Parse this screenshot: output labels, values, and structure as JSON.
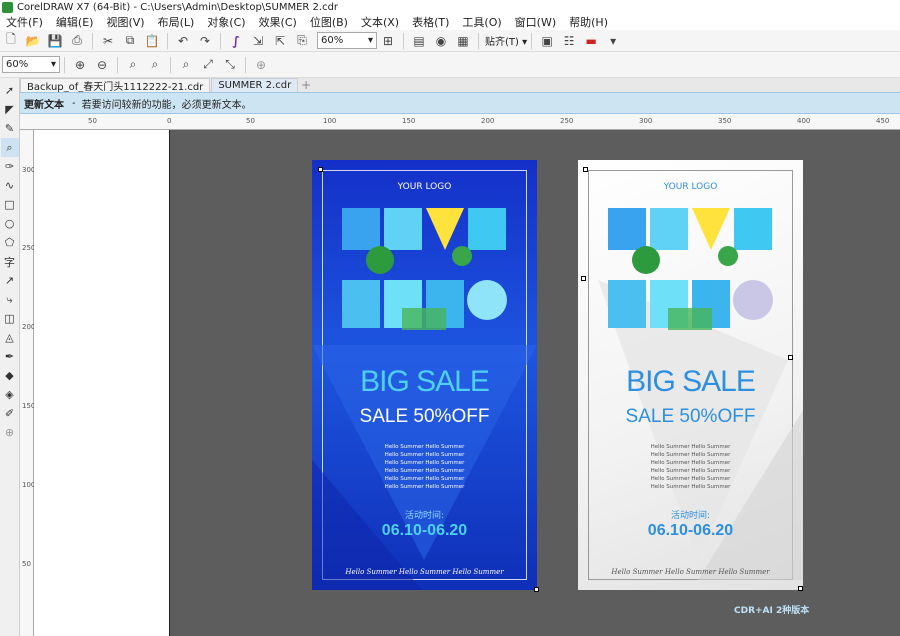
{
  "window": {
    "title": "CorelDRAW X7 (64-Bit) - C:\\Users\\Admin\\Desktop\\SUMMER 2.cdr"
  },
  "menu": [
    "文件(F)",
    "编辑(E)",
    "视图(V)",
    "布局(L)",
    "对象(C)",
    "效果(C)",
    "位图(B)",
    "文本(X)",
    "表格(T)",
    "工具(O)",
    "窗口(W)",
    "帮助(H)"
  ],
  "toolbar": {
    "zoom_value": "60%",
    "snap_label": "贴齐(T)",
    "zoom_level_2": "60%"
  },
  "tabs": [
    "Backup_of_春天门头1112222-21.cdr",
    "SUMMER 2.cdr"
  ],
  "infobar": {
    "title": "更新文本",
    "message": "若要访问较新的功能，必须更新文本。"
  },
  "ruler_h": [
    "50",
    "0",
    "50",
    "100",
    "150",
    "200",
    "250",
    "300",
    "350",
    "400",
    "450"
  ],
  "ruler_v": [
    "300",
    "250",
    "200",
    "150",
    "100",
    "50"
  ],
  "poster": {
    "logo": "YOUR LOGO",
    "big": "BIG SALE",
    "sale": "SALE 50%OFF",
    "hello_line": "Hello Summer Hello Summer",
    "hello_lines": [
      "Hello Summer Hello Summer",
      "Hello Summer Hello Summer",
      "Hello Summer Hello Summer",
      "Hello Summer Hello Summer",
      "Hello Summer Hello Summer",
      "Hello Summer Hello Summer"
    ],
    "activity": "活动时间:",
    "date": "06.10-06.20",
    "footer": "Hello Summer Hello Summer Hello Summer"
  },
  "caption": "CDR+AI 2种版本",
  "colors": {
    "blue_bg": "#1430c8",
    "cyan": "#4fd0f2",
    "infobar": "#cde4f3",
    "desktop": "#5d5d5d"
  }
}
